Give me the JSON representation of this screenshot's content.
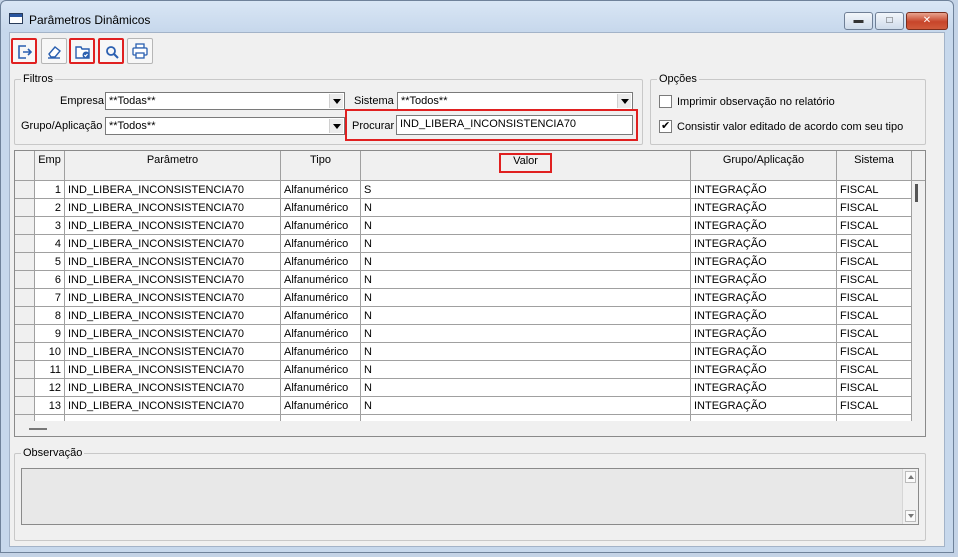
{
  "window": {
    "title": "Parâmetros Dinâmicos",
    "minimize_icon": "minimize-icon",
    "maximize_icon": "maximize-icon",
    "close_icon": "close-icon"
  },
  "toolbar": {
    "buttons": [
      {
        "icon": "exit-icon",
        "highlighted": true
      },
      {
        "icon": "eraser-icon",
        "highlighted": false
      },
      {
        "icon": "folder-check-icon",
        "highlighted": true
      },
      {
        "icon": "search-icon",
        "highlighted": true
      },
      {
        "icon": "print-icon",
        "highlighted": false
      }
    ]
  },
  "filters": {
    "label": "Filtros",
    "empresa_label": "Empresa",
    "empresa_value": "**Todas**",
    "sistema_label": "Sistema",
    "sistema_value": "**Todos**",
    "grupo_label": "Grupo/Aplicação",
    "grupo_value": "**Todos**",
    "procurar_label": "Procurar",
    "procurar_value": "IND_LIBERA_INCONSISTENCIA70"
  },
  "options": {
    "label": "Opções",
    "imprimir_label": "Imprimir observação no relatório",
    "imprimir_checked": false,
    "consistir_label": "Consistir valor editado de acordo com seu tipo",
    "consistir_checked": true
  },
  "grid": {
    "columns": [
      "Emp",
      "Parâmetro",
      "Tipo",
      "Valor",
      "Grupo/Aplicação",
      "Sistema"
    ],
    "rows": [
      {
        "emp": "1",
        "parametro": "IND_LIBERA_INCONSISTENCIA70",
        "tipo": "Alfanumérico",
        "valor": "S",
        "grupo": "INTEGRAÇÃO",
        "sistema": "FISCAL"
      },
      {
        "emp": "2",
        "parametro": "IND_LIBERA_INCONSISTENCIA70",
        "tipo": "Alfanumérico",
        "valor": "N",
        "grupo": "INTEGRAÇÃO",
        "sistema": "FISCAL"
      },
      {
        "emp": "3",
        "parametro": "IND_LIBERA_INCONSISTENCIA70",
        "tipo": "Alfanumérico",
        "valor": "N",
        "grupo": "INTEGRAÇÃO",
        "sistema": "FISCAL"
      },
      {
        "emp": "4",
        "parametro": "IND_LIBERA_INCONSISTENCIA70",
        "tipo": "Alfanumérico",
        "valor": "N",
        "grupo": "INTEGRAÇÃO",
        "sistema": "FISCAL"
      },
      {
        "emp": "5",
        "parametro": "IND_LIBERA_INCONSISTENCIA70",
        "tipo": "Alfanumérico",
        "valor": "N",
        "grupo": "INTEGRAÇÃO",
        "sistema": "FISCAL"
      },
      {
        "emp": "6",
        "parametro": "IND_LIBERA_INCONSISTENCIA70",
        "tipo": "Alfanumérico",
        "valor": "N",
        "grupo": "INTEGRAÇÃO",
        "sistema": "FISCAL"
      },
      {
        "emp": "7",
        "parametro": "IND_LIBERA_INCONSISTENCIA70",
        "tipo": "Alfanumérico",
        "valor": "N",
        "grupo": "INTEGRAÇÃO",
        "sistema": "FISCAL"
      },
      {
        "emp": "8",
        "parametro": "IND_LIBERA_INCONSISTENCIA70",
        "tipo": "Alfanumérico",
        "valor": "N",
        "grupo": "INTEGRAÇÃO",
        "sistema": "FISCAL"
      },
      {
        "emp": "9",
        "parametro": "IND_LIBERA_INCONSISTENCIA70",
        "tipo": "Alfanumérico",
        "valor": "N",
        "grupo": "INTEGRAÇÃO",
        "sistema": "FISCAL"
      },
      {
        "emp": "10",
        "parametro": "IND_LIBERA_INCONSISTENCIA70",
        "tipo": "Alfanumérico",
        "valor": "N",
        "grupo": "INTEGRAÇÃO",
        "sistema": "FISCAL"
      },
      {
        "emp": "11",
        "parametro": "IND_LIBERA_INCONSISTENCIA70",
        "tipo": "Alfanumérico",
        "valor": "N",
        "grupo": "INTEGRAÇÃO",
        "sistema": "FISCAL"
      },
      {
        "emp": "12",
        "parametro": "IND_LIBERA_INCONSISTENCIA70",
        "tipo": "Alfanumérico",
        "valor": "N",
        "grupo": "INTEGRAÇÃO",
        "sistema": "FISCAL"
      },
      {
        "emp": "13",
        "parametro": "IND_LIBERA_INCONSISTENCIA70",
        "tipo": "Alfanumérico",
        "valor": "N",
        "grupo": "INTEGRAÇÃO",
        "sistema": "FISCAL"
      }
    ]
  },
  "observacao": {
    "label": "Observação"
  },
  "colors": {
    "highlight": "#e02020",
    "title_bar": "#c7d8ec",
    "close_button": "#c7452a"
  }
}
